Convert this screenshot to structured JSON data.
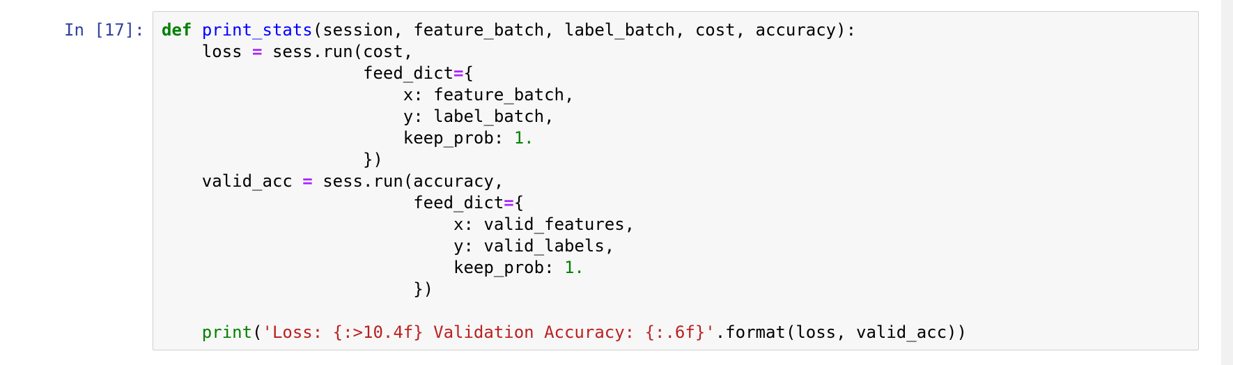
{
  "cell": {
    "prompt": "In [17]:",
    "lines": [
      [
        {
          "t": "def",
          "k": "kw"
        },
        {
          "t": " ",
          "k": "plain"
        },
        {
          "t": "print_stats",
          "k": "fn"
        },
        {
          "t": "(session, feature_batch, label_batch, cost, accuracy):",
          "k": "plain"
        }
      ],
      [
        {
          "t": "    loss ",
          "k": "plain"
        },
        {
          "t": "=",
          "k": "op"
        },
        {
          "t": " sess.run(cost,",
          "k": "plain"
        }
      ],
      [
        {
          "t": "                    feed_dict",
          "k": "plain"
        },
        {
          "t": "=",
          "k": "op"
        },
        {
          "t": "{",
          "k": "plain"
        }
      ],
      [
        {
          "t": "                        x: feature_batch,",
          "k": "plain"
        }
      ],
      [
        {
          "t": "                        y: label_batch,",
          "k": "plain"
        }
      ],
      [
        {
          "t": "                        keep_prob: ",
          "k": "plain"
        },
        {
          "t": "1.",
          "k": "num"
        }
      ],
      [
        {
          "t": "                    })",
          "k": "plain"
        }
      ],
      [
        {
          "t": "    valid_acc ",
          "k": "plain"
        },
        {
          "t": "=",
          "k": "op"
        },
        {
          "t": " sess.run(accuracy,",
          "k": "plain"
        }
      ],
      [
        {
          "t": "                         feed_dict",
          "k": "plain"
        },
        {
          "t": "=",
          "k": "op"
        },
        {
          "t": "{",
          "k": "plain"
        }
      ],
      [
        {
          "t": "                             x: valid_features,",
          "k": "plain"
        }
      ],
      [
        {
          "t": "                             y: valid_labels,",
          "k": "plain"
        }
      ],
      [
        {
          "t": "                             keep_prob: ",
          "k": "plain"
        },
        {
          "t": "1.",
          "k": "num"
        }
      ],
      [
        {
          "t": "                         })",
          "k": "plain"
        }
      ],
      [],
      [
        {
          "t": "    ",
          "k": "plain"
        },
        {
          "t": "print",
          "k": "kw-plain"
        },
        {
          "t": "(",
          "k": "plain"
        },
        {
          "t": "'Loss: {:>10.4f} Validation Accuracy: {:.6f}'",
          "k": "str"
        },
        {
          "t": ".format(loss, valid_acc))",
          "k": "plain"
        }
      ]
    ]
  },
  "colors": {
    "prompt": "#303f9f",
    "keyword": "#008000",
    "function_name": "#0000ff",
    "operator": "#aa22ff",
    "number": "#008000",
    "string": "#ba2121",
    "cell_background": "#f7f7f7",
    "cell_border": "#cfcfcf"
  }
}
